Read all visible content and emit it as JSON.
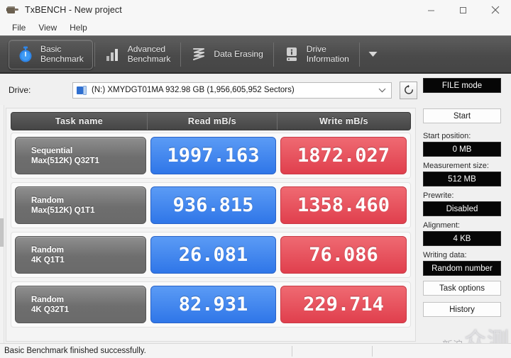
{
  "window": {
    "title": "TxBENCH - New project",
    "app_icon": "plug-icon",
    "buttons": {
      "minimize": "minimize-icon",
      "maximize": "maximize-icon",
      "close": "close-icon"
    }
  },
  "menubar": {
    "items": [
      {
        "label": "File"
      },
      {
        "label": "View"
      },
      {
        "label": "Help"
      }
    ]
  },
  "tabs": {
    "items": [
      {
        "label": "Basic\nBenchmark",
        "icon": "stopwatch-icon",
        "active": true
      },
      {
        "label": "Advanced\nBenchmark",
        "icon": "bar-chart-icon",
        "active": false
      },
      {
        "label": "Data Erasing",
        "icon": "shred-icon",
        "active": false
      },
      {
        "label": "Drive\nInformation",
        "icon": "drive-info-icon",
        "active": false
      }
    ],
    "overflow_icon": "chevron-down-icon"
  },
  "drive": {
    "label": "Drive:",
    "icon": "hdd-icon",
    "value": "(N:) XMYDGT01MA  932.98 GB (1,956,605,952 Sectors)",
    "dropdown_icon": "chevron-down-icon",
    "refresh_icon": "refresh-icon"
  },
  "results": {
    "columns": [
      "Task name",
      "Read mB/s",
      "Write mB/s"
    ],
    "rows": [
      {
        "task": "Sequential\nMax(512K) Q32T1",
        "read": "1997.163",
        "write": "1872.027"
      },
      {
        "task": "Random\nMax(512K) Q1T1",
        "read": "936.815",
        "write": "1358.460"
      },
      {
        "task": "Random\n4K Q1T1",
        "read": "26.081",
        "write": "76.086"
      },
      {
        "task": "Random\n4K Q32T1",
        "read": "82.931",
        "write": "229.714"
      }
    ]
  },
  "sidebar": {
    "mode_button": "FILE mode",
    "start_button": "Start",
    "settings": [
      {
        "caption": "Start position:",
        "value": "0 MB"
      },
      {
        "caption": "Measurement size:",
        "value": "512 MB"
      },
      {
        "caption": "Prewrite:",
        "value": "Disabled"
      },
      {
        "caption": "Alignment:",
        "value": "4 KB"
      },
      {
        "caption": "Writing data:",
        "value": "Random number"
      }
    ],
    "task_options_button": "Task options",
    "history_button": "History"
  },
  "statusbar": {
    "message": "Basic Benchmark finished successfully."
  },
  "watermark": {
    "small": "新浪",
    "big": "众测"
  },
  "colors": {
    "read_chip": "#3b82f0",
    "write_chip": "#e8505b",
    "tabstrip": "#4a4a4a",
    "task_chip": "#6e6e6e",
    "dark_field": "#060606"
  }
}
